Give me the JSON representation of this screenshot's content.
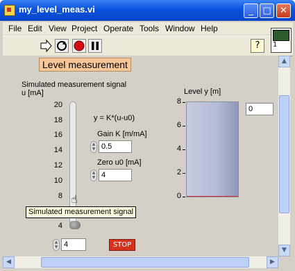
{
  "window": {
    "title": "my_level_meas.vi",
    "buttons": {
      "minimize": "_",
      "maximize": "□",
      "close": "✕"
    }
  },
  "menubar": {
    "items": [
      "File",
      "Edit",
      "View",
      "Project",
      "Operate",
      "Tools",
      "Window",
      "Help"
    ]
  },
  "toolbar": {
    "help_label": "?",
    "connector_pane_number": "1"
  },
  "panel": {
    "heading": "Level measurement",
    "signal": {
      "label_line1": "Simulated measurement signal",
      "label_line2": "u [mA]",
      "ticks": [
        "20",
        "18",
        "16",
        "14",
        "12",
        "10",
        "8",
        "6",
        "4"
      ],
      "value": "4",
      "level_fraction": 0.0,
      "tooltip": "Simulated measurement signal"
    },
    "formula": "y = K*(u-u0)",
    "gain": {
      "label": "Gain K [m/mA]",
      "value": "0.5"
    },
    "zero": {
      "label": "Zero u0 [mA]",
      "value": "4"
    },
    "tank": {
      "label": "Level y [m]",
      "ticks": [
        "8",
        "6",
        "4",
        "2",
        "0"
      ],
      "value": "0",
      "level_fraction": 0.0
    },
    "stop_label": "STOP"
  },
  "colors": {
    "titlebar": "#0a52dd",
    "heading_bg": "#f7c79a",
    "stop_button": "#d7311c",
    "tank_fill": "#d03030"
  }
}
